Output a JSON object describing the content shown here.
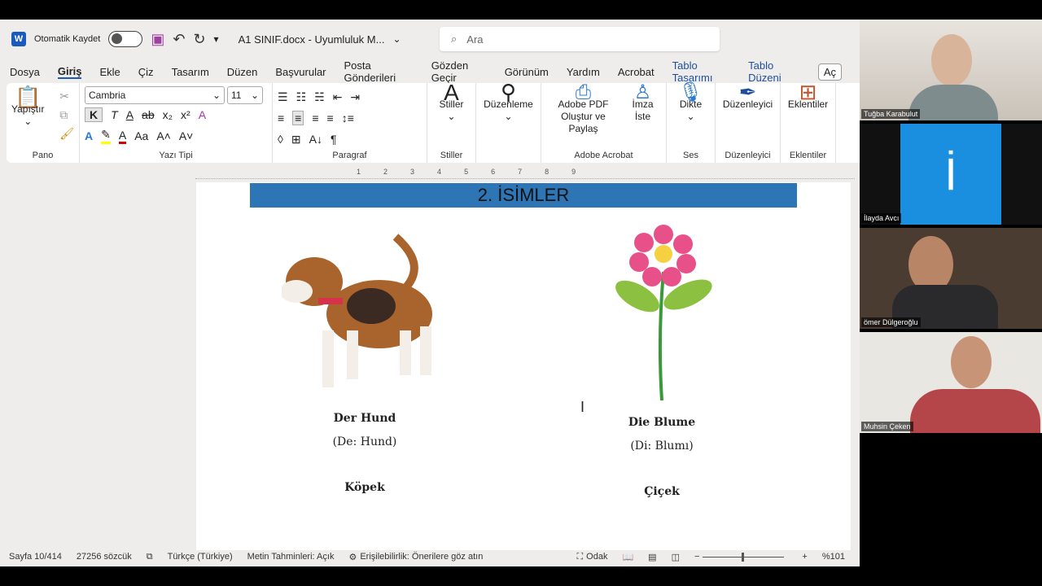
{
  "titlebar": {
    "autosave_label": "Otomatik Kaydet",
    "doc_title": "A1 SINIF.docx  -  Uyumluluk M...",
    "search_placeholder": "Ara"
  },
  "menu": [
    "Dosya",
    "Giriş",
    "Ekle",
    "Çiz",
    "Tasarım",
    "Düzen",
    "Başvurular",
    "Posta Gönderileri",
    "Gözden Geçir",
    "Görünüm",
    "Yardım",
    "Acrobat",
    "Tablo Tasarımı",
    "Tablo Düzeni"
  ],
  "menu_extra": "Aç",
  "ribbon": {
    "paste": "Yapıştır",
    "pano": "Pano",
    "font": "Cambria",
    "size": "11",
    "bold": "K",
    "italic": "T",
    "yazi_tipi": "Yazı Tipi",
    "paragraf": "Paragraf",
    "stiller": "Stiller",
    "duzenleme": "Düzenleme",
    "adobe_pdf": "Adobe PDF Oluştur ve Paylaş",
    "imza": "İmza İste",
    "adobe_group": "Adobe Acrobat",
    "dikte": "Dikte",
    "ses": "Ses",
    "duzenleyici": "Düzenleyici",
    "eklentiler": "Eklentiler"
  },
  "ruler_numbers": [
    "1",
    "1",
    "2",
    "3",
    "4",
    "5",
    "6",
    "7",
    "8",
    "9"
  ],
  "document": {
    "heading": "2. İSİMLER",
    "items": [
      {
        "word": "Der Hund",
        "pron": "(De: Hund)",
        "tr": "Köpek",
        "image": "dog-illustration"
      },
      {
        "word": "Die Blume",
        "pron": "(Di: Blumı)",
        "tr": "Çiçek",
        "image": "flower-illustration"
      }
    ]
  },
  "status": {
    "page": "Sayfa 10/414",
    "words": "27256 sözcük",
    "language": "Türkçe (Türkiye)",
    "predictions": "Metin Tahminleri: Açık",
    "accessibility": "Erişilebilirlik: Önerilere göz atın",
    "focus": "Odak",
    "zoom": "%101",
    "zoom_level": 101
  },
  "participants": [
    {
      "name": "Tuğba Karabulut"
    },
    {
      "name": "İlayda Avcı",
      "initial": "İ"
    },
    {
      "name": "ömer Dülgeroğlu"
    },
    {
      "name": "Muhsin Çeken"
    }
  ],
  "colors": {
    "word_blue": "#185abd",
    "banner": "#2e75b6",
    "tile_blue": "#1a8fe0"
  }
}
